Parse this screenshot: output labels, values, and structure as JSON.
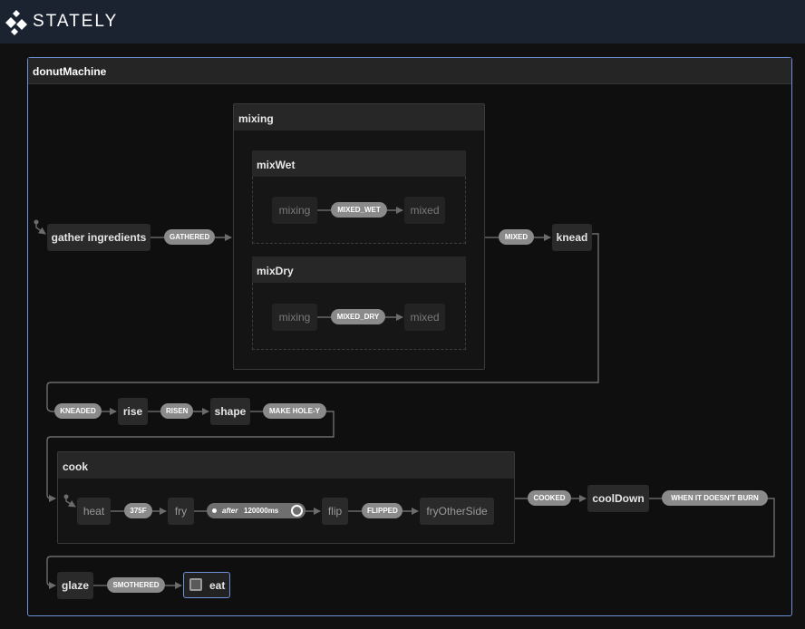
{
  "app": {
    "brand": "STATELY"
  },
  "machine": {
    "title": "donutMachine"
  },
  "groups": {
    "mixing": "mixing",
    "mixWet": "mixWet",
    "mixDry": "mixDry",
    "cook": "cook"
  },
  "states": {
    "gather": "gather ingredients",
    "knead": "knead",
    "rise": "rise",
    "shape": "shape",
    "heat": "heat",
    "fry": "fry",
    "flip": "flip",
    "fryOtherSide": "fryOtherSide",
    "coolDown": "coolDown",
    "glaze": "glaze",
    "eat": "eat",
    "wetMixing": "mixing",
    "wetMixed": "mixed",
    "dryMixing": "mixing",
    "dryMixed": "mixed"
  },
  "events": {
    "gathered": "GATHERED",
    "mixed": "MIXED",
    "mixedWet": "MIXED_WET",
    "mixedDry": "MIXED_DRY",
    "kneaded": "KNEADED",
    "risen": "RISEN",
    "makeHole": "MAKE HOLE-Y",
    "temp": "375F",
    "afterLabel": "after",
    "afterValue": "120000ms",
    "flipped": "FLIPPED",
    "cooked": "COOKED",
    "burn": "WHEN IT DOESN'T BURN",
    "smothered": "SMOTHERED"
  }
}
